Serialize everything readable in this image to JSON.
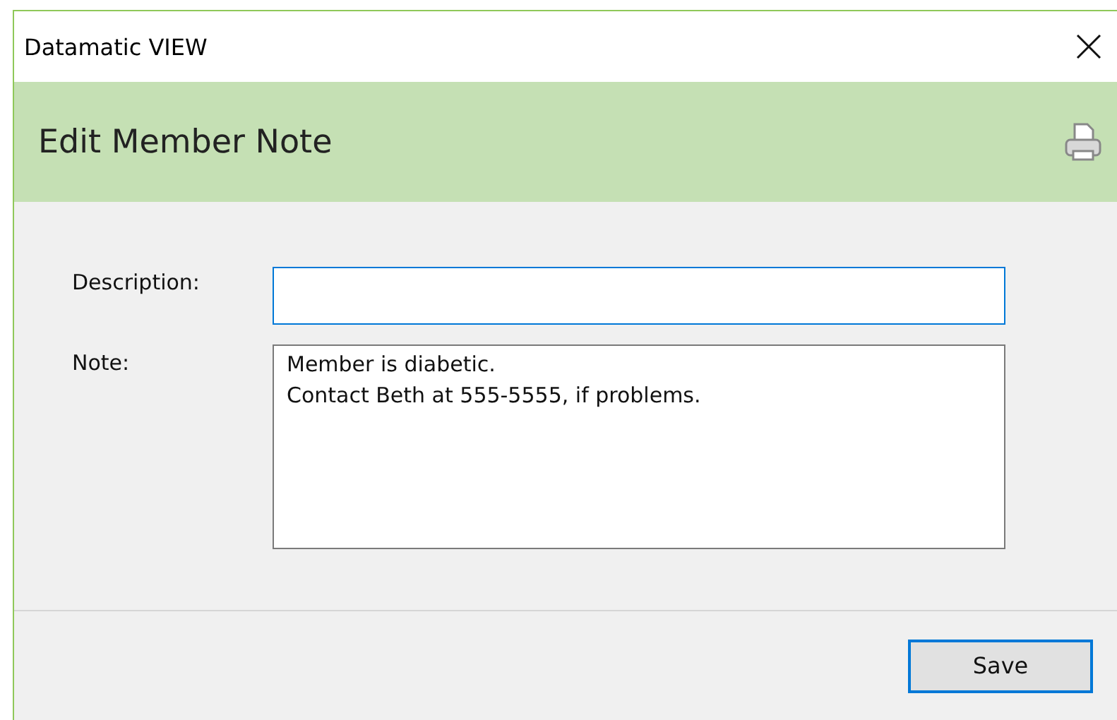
{
  "window": {
    "title": "Datamatic VIEW"
  },
  "header": {
    "title": "Edit Member Note"
  },
  "fields": [
    {
      "kind": "input",
      "label": "Description:",
      "focused": true
    },
    {
      "kind": "textarea",
      "label": "Note:",
      "value": "Member is diabetic.\nContact Beth at 555-5555, if problems.",
      "focused": false
    }
  ],
  "buttons": [
    {
      "label": "Save",
      "default": true
    }
  ]
}
